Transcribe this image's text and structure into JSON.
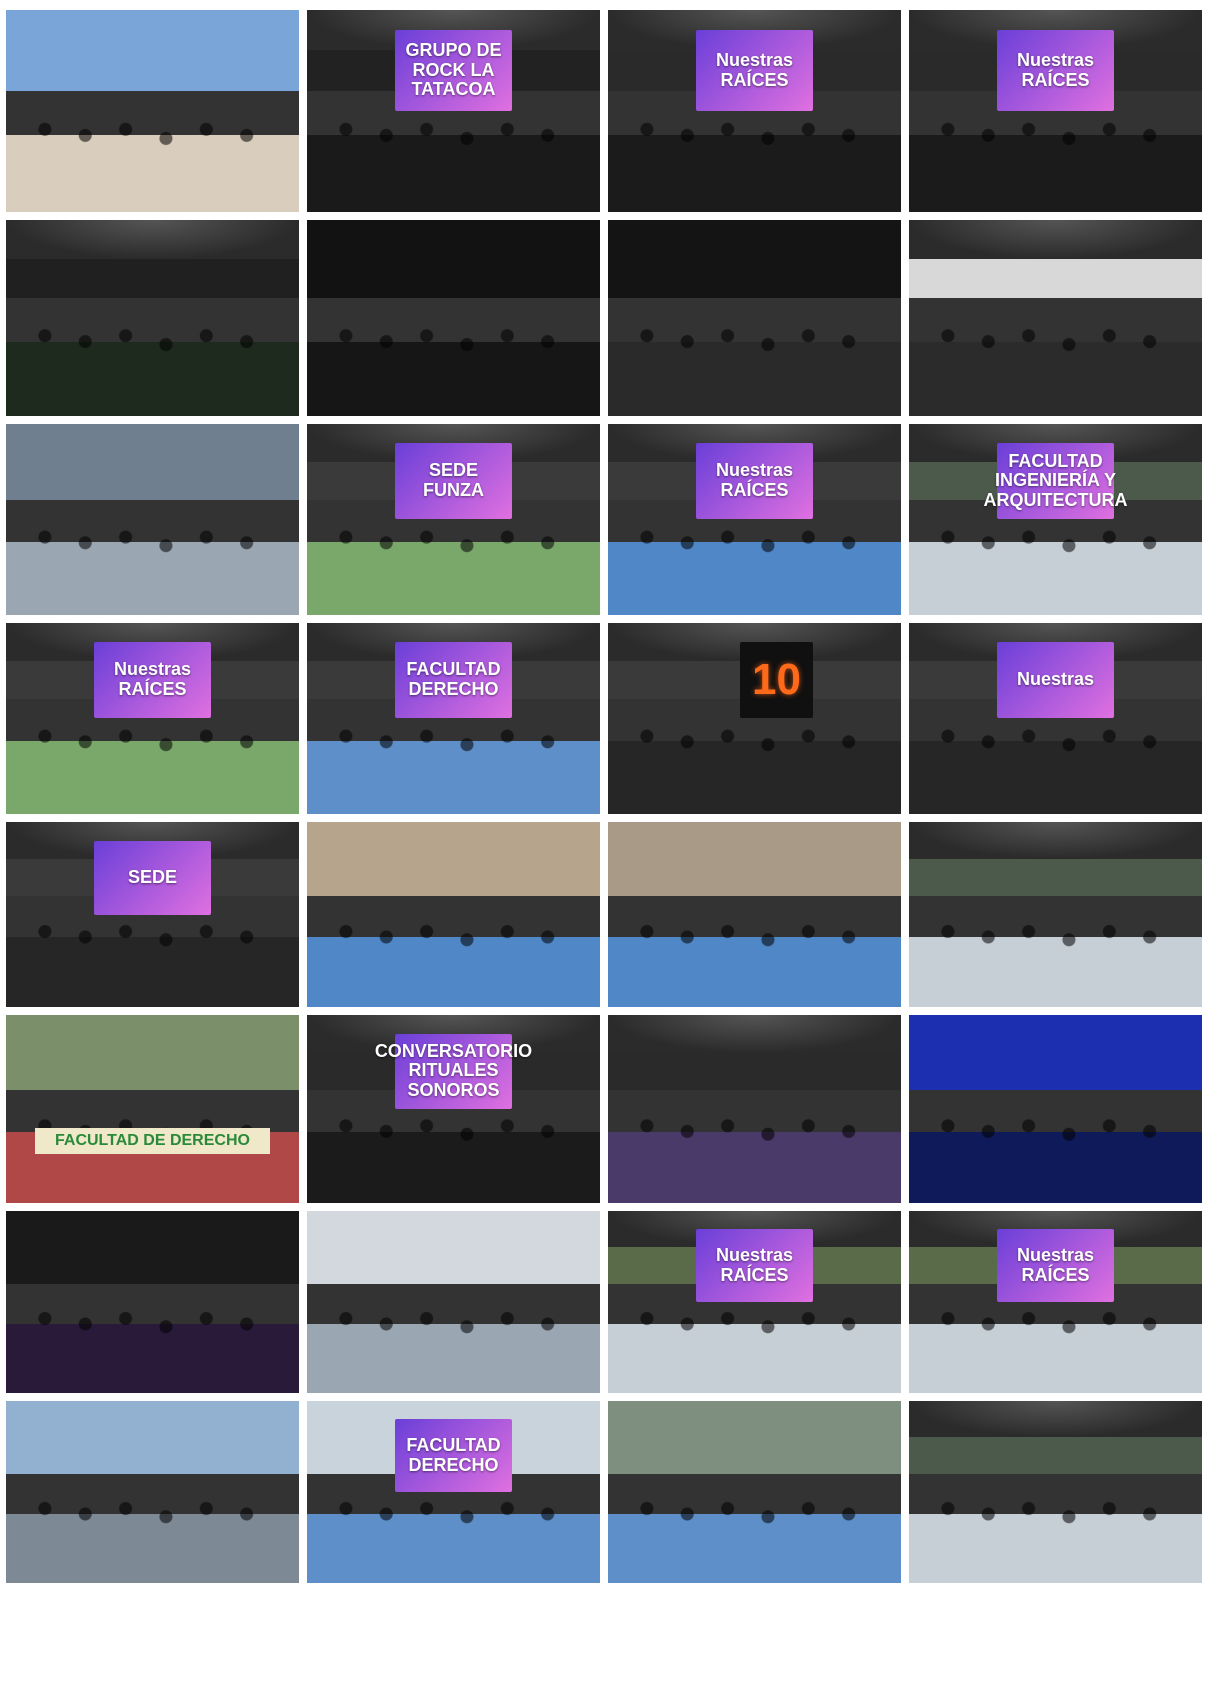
{
  "gallery": {
    "photos": [
      {
        "id": "p1",
        "kind": "outdoor-day",
        "sky": "#7aa5d8",
        "ground": "#d9cdbd",
        "screen_text": "",
        "banner_text": ""
      },
      {
        "id": "p2",
        "kind": "stage-night",
        "sky": "#222",
        "ground": "#1a1a1a",
        "screen_text": "GRUPO DE\nROCK LA TATACOA",
        "banner_text": ""
      },
      {
        "id": "p3",
        "kind": "stage-night",
        "sky": "#2a2a2a",
        "ground": "#1b1b1b",
        "screen_text": "Nuestras\nRAÍCES",
        "banner_text": ""
      },
      {
        "id": "p4",
        "kind": "stage-night",
        "sky": "#2a2a2a",
        "ground": "#1b1b1b",
        "screen_text": "Nuestras\nRAÍCES",
        "banner_text": ""
      },
      {
        "id": "p5",
        "kind": "stage-green",
        "sky": "#202020",
        "ground": "#1d2a1d",
        "screen_text": "",
        "banner_text": ""
      },
      {
        "id": "p6",
        "kind": "crowd-night",
        "sky": "#121212",
        "ground": "#161616",
        "screen_text": "",
        "banner_text": ""
      },
      {
        "id": "p7",
        "kind": "crowd-night",
        "sky": "#141414",
        "ground": "#2a2a2a",
        "screen_text": "",
        "banner_text": ""
      },
      {
        "id": "p8",
        "kind": "stage-night",
        "sky": "#d8d8d8",
        "ground": "#2b2b2b",
        "screen_text": "",
        "banner_text": ""
      },
      {
        "id": "p9",
        "kind": "outdoor-day",
        "sky": "#6f7f8f",
        "ground": "#9aa7b3",
        "screen_text": "",
        "banner_text": ""
      },
      {
        "id": "p10",
        "kind": "stage-day",
        "sky": "#3a3a3a",
        "ground": "#7aa86a",
        "screen_text": "SEDE\nFUNZA",
        "banner_text": ""
      },
      {
        "id": "p11",
        "kind": "stage-day",
        "sky": "#3a3a3a",
        "ground": "#4f87c7",
        "screen_text": "Nuestras\nRAÍCES",
        "banner_text": ""
      },
      {
        "id": "p12",
        "kind": "stage-day",
        "sky": "#4b5a4b",
        "ground": "#c7cfd6",
        "screen_text": "FACULTAD\nINGENIERÍA Y\nARQUITECTURA",
        "banner_text": ""
      },
      {
        "id": "p13",
        "kind": "stage-day",
        "sky": "#3a3a3a",
        "ground": "#7aa86a",
        "screen_text": "Nuestras\nRAÍCES",
        "banner_text": ""
      },
      {
        "id": "p14",
        "kind": "stage-day",
        "sky": "#3a3a3a",
        "ground": "#5e8fc8",
        "screen_text": "FACULTAD\nDERECHO",
        "banner_text": ""
      },
      {
        "id": "p15",
        "kind": "stage-day",
        "sky": "#3a3a3a",
        "ground": "#262626",
        "screen_text": "10",
        "banner_text": ""
      },
      {
        "id": "p16",
        "kind": "stage-day",
        "sky": "#3a3a3a",
        "ground": "#262626",
        "screen_text": "Nuestras",
        "banner_text": ""
      },
      {
        "id": "p17",
        "kind": "stage-day",
        "sky": "#3a3a3a",
        "ground": "#262626",
        "screen_text": "SEDE",
        "banner_text": ""
      },
      {
        "id": "p18",
        "kind": "outdoor-day",
        "sky": "#b7a48c",
        "ground": "#4f87c7",
        "screen_text": "",
        "banner_text": ""
      },
      {
        "id": "p19",
        "kind": "outdoor-day",
        "sky": "#a89a86",
        "ground": "#4f87c7",
        "screen_text": "",
        "banner_text": ""
      },
      {
        "id": "p20",
        "kind": "stage-day",
        "sky": "#4b5a4b",
        "ground": "#c7cfd6",
        "screen_text": "",
        "banner_text": ""
      },
      {
        "id": "p21",
        "kind": "outdoor-day",
        "sky": "#7a8f6a",
        "ground": "#b04848",
        "screen_text": "",
        "banner_text": "FACULTAD DE DERECHO"
      },
      {
        "id": "p22",
        "kind": "stage-night",
        "sky": "#2a2a2a",
        "ground": "#1b1b1b",
        "screen_text": "CONVERSATORIO\nRITUALES\nSONOROS",
        "banner_text": ""
      },
      {
        "id": "p23",
        "kind": "stage-night",
        "sky": "#2a2a2a",
        "ground": "#4a3a6a",
        "screen_text": "",
        "banner_text": ""
      },
      {
        "id": "p24",
        "kind": "crowd-blue",
        "sky": "#1c2fb0",
        "ground": "#0f1a5a",
        "screen_text": "",
        "banner_text": ""
      },
      {
        "id": "p25",
        "kind": "crowd-night",
        "sky": "#1a1a1a",
        "ground": "#2a1a3a",
        "screen_text": "",
        "banner_text": ""
      },
      {
        "id": "p26",
        "kind": "outdoor-day",
        "sky": "#d2d8de",
        "ground": "#9aa7b3",
        "screen_text": "",
        "banner_text": ""
      },
      {
        "id": "p27",
        "kind": "stage-day",
        "sky": "#5a6b4a",
        "ground": "#c7cfd6",
        "screen_text": "Nuestras\nRAÍCES",
        "banner_text": ""
      },
      {
        "id": "p28",
        "kind": "stage-day",
        "sky": "#5a6b4a",
        "ground": "#c7cfd6",
        "screen_text": "Nuestras\nRAÍCES",
        "banner_text": ""
      },
      {
        "id": "p29",
        "kind": "outdoor-day",
        "sky": "#92b0cf",
        "ground": "#7d8a96",
        "screen_text": "",
        "banner_text": ""
      },
      {
        "id": "p30",
        "kind": "outdoor-day",
        "sky": "#c9d3dc",
        "ground": "#5e8fc8",
        "screen_text": "FACULTAD\nDERECHO",
        "banner_text": ""
      },
      {
        "id": "p31",
        "kind": "outdoor-day",
        "sky": "#7f8f7f",
        "ground": "#5e8fc8",
        "screen_text": "",
        "banner_text": ""
      },
      {
        "id": "p32",
        "kind": "stage-day",
        "sky": "#4b5a4b",
        "ground": "#c7cfd6",
        "screen_text": "",
        "banner_text": ""
      }
    ]
  }
}
